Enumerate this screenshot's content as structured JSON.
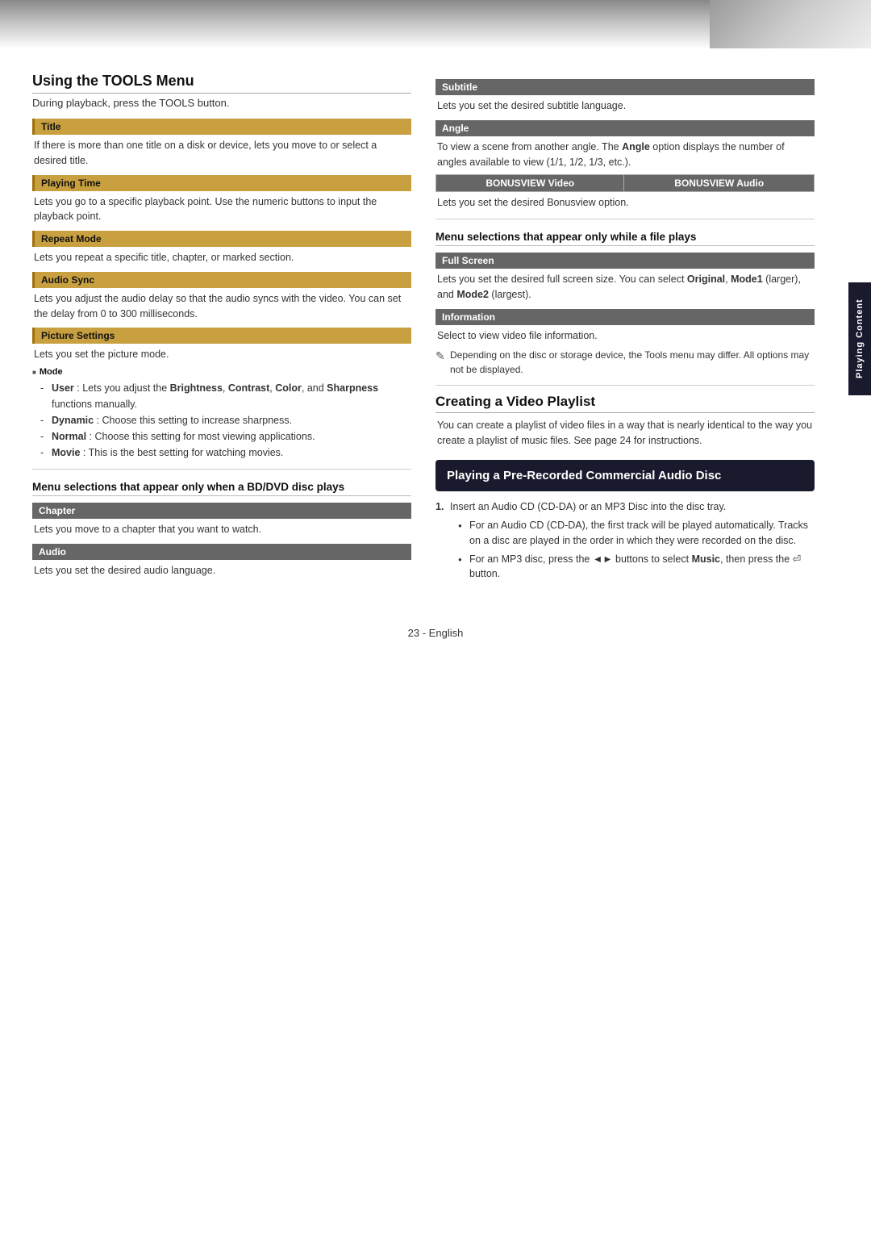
{
  "header": {
    "gradient": true
  },
  "sideTab": {
    "label": "Playing Content"
  },
  "leftColumn": {
    "sectionTitle": "Using the TOOLS Menu",
    "sectionSubtitle": "During playback, press the TOOLS button.",
    "items": [
      {
        "header": "Title",
        "headerStyle": "gold",
        "body": "If there is more than one title on a disk or device, lets you move to or select a desired title."
      },
      {
        "header": "Playing Time",
        "headerStyle": "gold",
        "body": "Lets you go to a specific playback point. Use the numeric buttons to input the playback point."
      },
      {
        "header": "Repeat Mode",
        "headerStyle": "gold",
        "body": "Lets you repeat a specific title, chapter, or marked section."
      },
      {
        "header": "Audio Sync",
        "headerStyle": "gold",
        "body": "Lets you adjust the audio delay so that the audio syncs with the video. You can set the delay from 0 to 300 milliseconds."
      },
      {
        "header": "Picture Settings",
        "headerStyle": "gold",
        "body": "Lets you set the picture mode.",
        "hasMode": true,
        "modeLabel": "Mode",
        "modeItems": [
          {
            "label": "User",
            "text": ": Lets you adjust the Brightness, Contrast, Color, and Sharpness functions manually."
          },
          {
            "label": "Dynamic",
            "text": ": Choose this setting to increase sharpness."
          },
          {
            "label": "Normal",
            "text": ": Choose this setting for most viewing applications."
          },
          {
            "label": "Movie",
            "text": ": This is the best setting for watching movies."
          }
        ]
      }
    ],
    "bdSection": {
      "title": "Menu selections that appear only when a BD/DVD disc plays",
      "items": [
        {
          "header": "Chapter",
          "headerStyle": "dark",
          "body": "Lets you move to a chapter that you want to watch."
        },
        {
          "header": "Audio",
          "headerStyle": "dark",
          "body": "Lets you set the desired audio language."
        }
      ]
    }
  },
  "rightColumn": {
    "subtitleItem": {
      "header": "Subtitle",
      "headerStyle": "dark",
      "body": "Lets you set the desired subtitle language."
    },
    "angleItem": {
      "header": "Angle",
      "headerStyle": "dark",
      "body": "To view a scene from another angle. The Angle option displays the number of angles available to view (1/1, 1/2, 1/3, etc.)."
    },
    "bonusviewTable": {
      "col1": "BONUSVIEW Video",
      "col2": "BONUSVIEW Audio",
      "body": "Lets you set the desired Bonusview option."
    },
    "fileSection": {
      "title": "Menu selections that appear only while a file plays",
      "items": [
        {
          "header": "Full Screen",
          "headerStyle": "dark",
          "body": "Lets you set the desired full screen size. You can select Original, Mode1 (larger), and Mode2 (largest)."
        },
        {
          "header": "Information",
          "headerStyle": "dark",
          "body": "Select to view video file information."
        }
      ],
      "note": "Depending on the disc or storage device, the Tools menu may differ. All options may not be displayed."
    },
    "creatingSection": {
      "title": "Creating a Video Playlist",
      "body": "You can create a playlist of video files in a way that is nearly identical to the way you create a playlist of music files. See page 24 for instructions."
    },
    "prrSection": {
      "boxTitle": "Playing a Pre-Recorded Commercial Audio Disc",
      "step1": "Insert an Audio CD (CD-DA) or an MP3 Disc into the disc tray.",
      "bullets": [
        "For an Audio CD (CD-DA), the first track will be played automatically. Tracks on a disc are played in the order in which they were recorded on the disc.",
        "For an MP3 disc, press the ◄► buttons to select Music, then press the ⏎ button."
      ]
    }
  },
  "footer": {
    "pageNum": "23",
    "lang": "English",
    "text": "23 - English"
  }
}
